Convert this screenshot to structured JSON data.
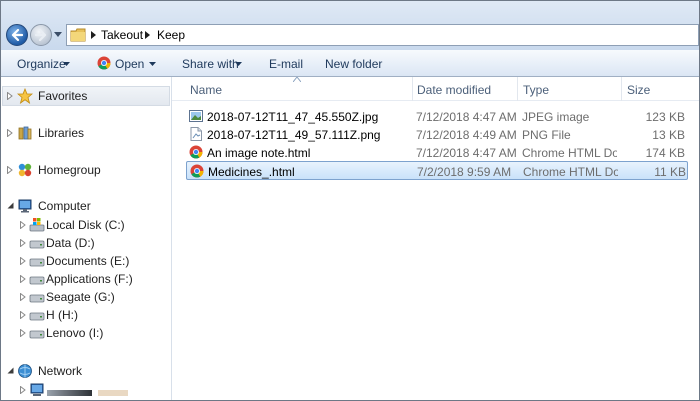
{
  "breadcrumb": [
    "Takeout",
    "Keep"
  ],
  "toolbar": {
    "organize": "Organize",
    "open": "Open",
    "share_with": "Share with",
    "email": "E-mail",
    "new_folder": "New folder"
  },
  "nav": {
    "favorites": "Favorites",
    "libraries": "Libraries",
    "homegroup": "Homegroup",
    "computer": "Computer",
    "drives": [
      "Local Disk (C:)",
      "Data (D:)",
      "Documents (E:)",
      "Applications (F:)",
      "Seagate (G:)",
      "H (H:)",
      "Lenovo (I:)"
    ],
    "network": "Network"
  },
  "columns": {
    "name": "Name",
    "date": "Date modified",
    "type": "Type",
    "size": "Size"
  },
  "files": [
    {
      "name": "2018-07-12T11_47_45.550Z.jpg",
      "date": "7/12/2018 4:47 AM",
      "type": "JPEG image",
      "size": "123 KB",
      "icon": "jpg-image-icon"
    },
    {
      "name": "2018-07-12T11_49_57.111Z.png",
      "date": "7/12/2018 4:49 AM",
      "type": "PNG File",
      "size": "13 KB",
      "icon": "png-file-icon"
    },
    {
      "name": "An image note.html",
      "date": "7/12/2018 4:47 AM",
      "type": "Chrome HTML Do...",
      "size": "174 KB",
      "icon": "chrome-icon"
    },
    {
      "name": "Medicines_.html",
      "date": "7/2/2018 9:59 AM",
      "type": "Chrome HTML Do...",
      "size": "11 KB",
      "icon": "chrome-icon"
    }
  ],
  "selected_file": "Medicines_.html",
  "colors": {
    "accent": "#1f5ba6",
    "selection": "#c9e2fa",
    "text": "#1e395b"
  }
}
